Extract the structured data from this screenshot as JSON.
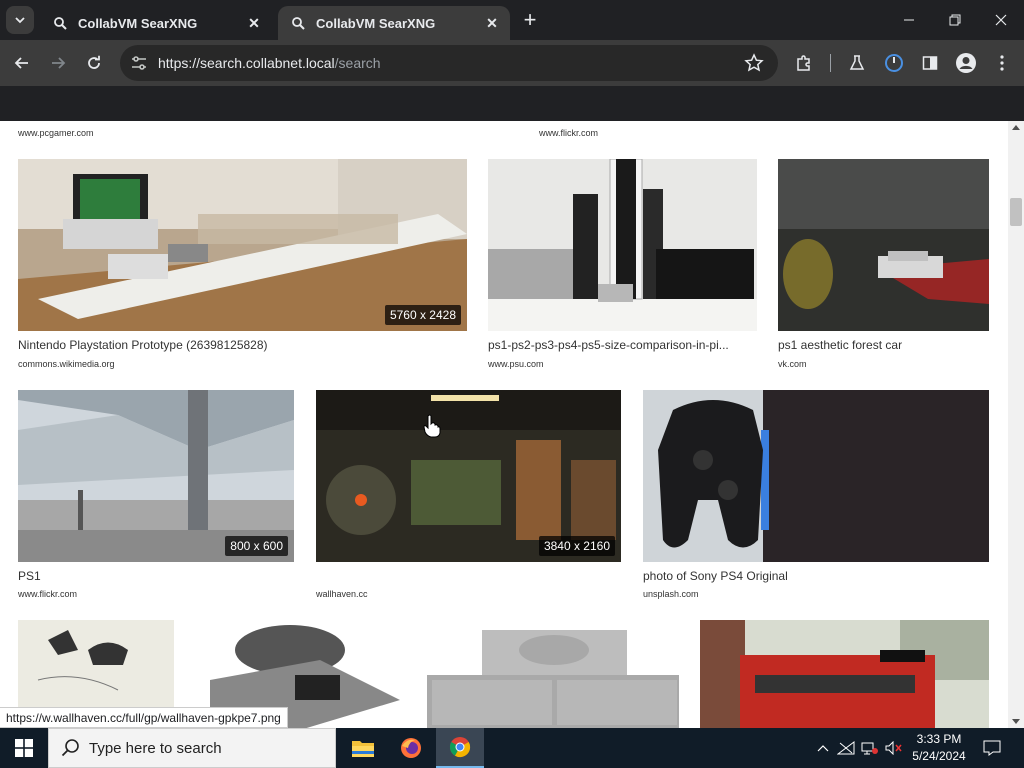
{
  "browser": {
    "tabs": [
      {
        "label": "CollabVM SearXNG",
        "active": false
      },
      {
        "label": "CollabVM SearXNG",
        "active": true
      }
    ],
    "address": {
      "host": "https://search.collabnet.local",
      "path": "/search"
    },
    "status_url": "https://w.wallhaven.cc/full/gp/wallhaven-gpkpe7.png"
  },
  "results": {
    "top_partial": [
      {
        "source": "www.pcgamer.com"
      },
      {
        "source": "www.flickr.com"
      }
    ],
    "row1": [
      {
        "title": "Nintendo Playstation Prototype (26398125828)",
        "source": "commons.wikimedia.org",
        "resolution": "5760 x 2428"
      },
      {
        "title": "ps1-ps2-ps3-ps4-ps5-size-comparison-in-pi...",
        "source": "www.psu.com",
        "resolution": ""
      },
      {
        "title": "ps1 aesthetic forest car",
        "source": "vk.com",
        "resolution": ""
      }
    ],
    "row2": [
      {
        "title": "PS1",
        "source": "www.flickr.com",
        "resolution": "800 x 600"
      },
      {
        "title": "",
        "source": "wallhaven.cc",
        "resolution": "3840 x 2160"
      },
      {
        "title": "photo of Sony PS4 Original",
        "source": "unsplash.com",
        "resolution": ""
      }
    ]
  },
  "taskbar": {
    "search_placeholder": "Type here to search",
    "time": "3:33 PM",
    "date": "5/24/2024"
  },
  "colors": {
    "titlebar": "#202124",
    "toolbar": "#3c3c3c",
    "omnibox": "#282828",
    "taskbar": "#101c28"
  }
}
